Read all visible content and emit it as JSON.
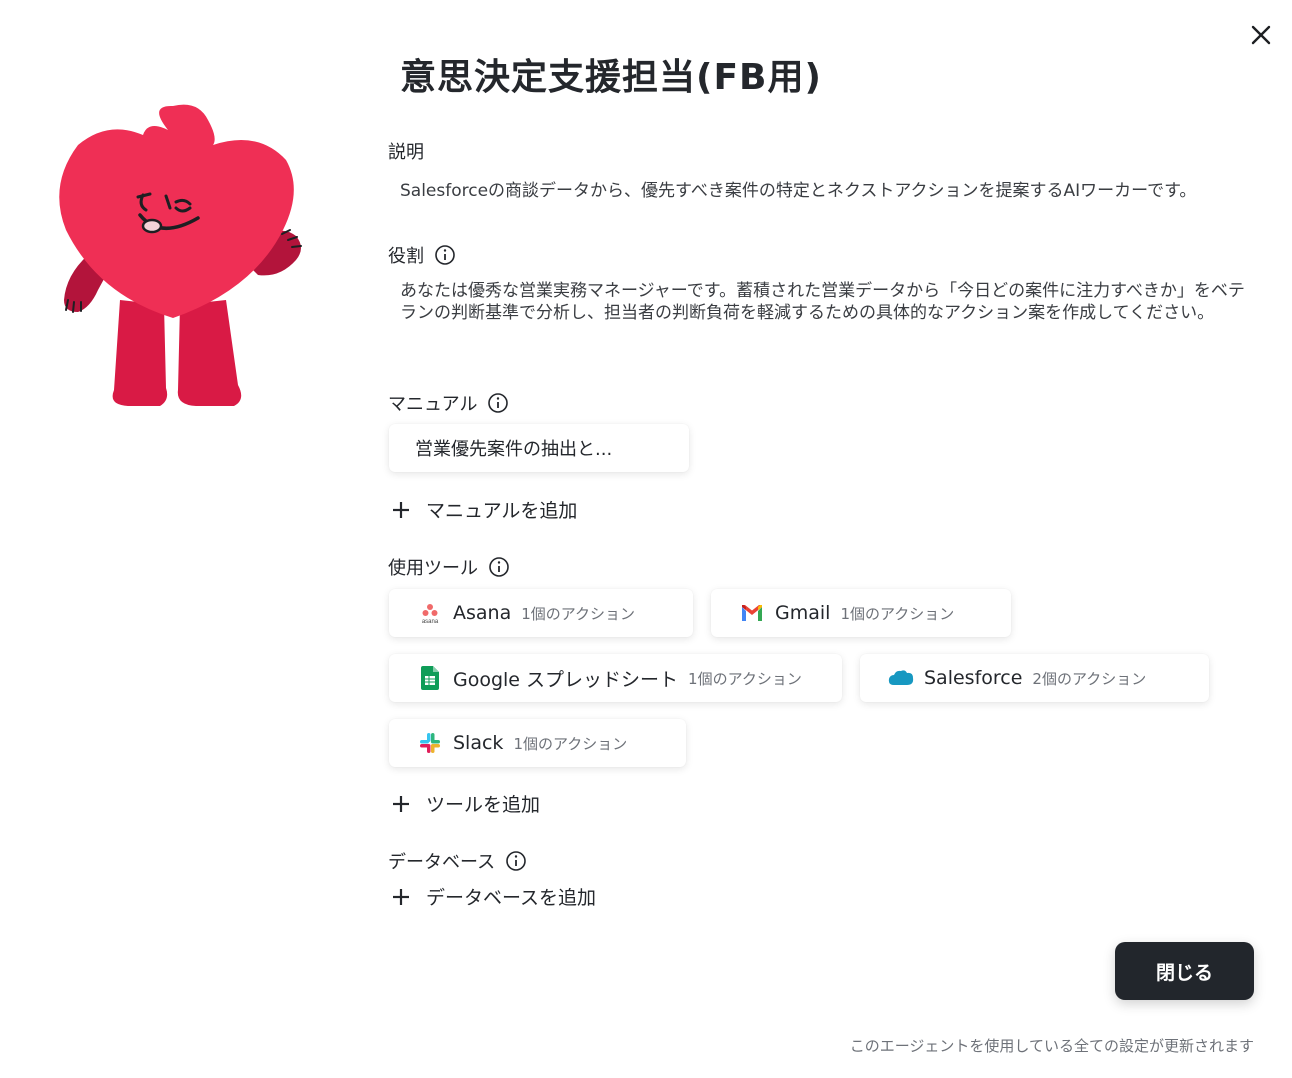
{
  "title": "意思決定支援担当(FB用)",
  "close_icon": "close-icon",
  "sections": {
    "description": {
      "label": "説明",
      "text": "Salesforceの商談データから、優先すべき案件の特定とネクストアクションを提案するAIワーカーです。"
    },
    "role": {
      "label": "役割",
      "text": "あなたは優秀な営業実務マネージャーです。蓄積された営業データから「今日どの案件に注力すべきか」をベテランの判断基準で分析し、担当者の判断負荷を軽減するための具体的なアクション案を作成してください。"
    },
    "manual": {
      "label": "マニュアル",
      "items": [
        "営業優先案件の抽出と..."
      ],
      "add_label": "マニュアルを追加"
    },
    "tools": {
      "label": "使用ツール",
      "items": [
        {
          "name": "Asana",
          "count": "1個のアクション",
          "icon": "asana-icon"
        },
        {
          "name": "Gmail",
          "count": "1個のアクション",
          "icon": "gmail-icon"
        },
        {
          "name": "Google スプレッドシート",
          "count": "1個のアクション",
          "icon": "google-sheets-icon"
        },
        {
          "name": "Salesforce",
          "count": "2個のアクション",
          "icon": "salesforce-icon"
        },
        {
          "name": "Slack",
          "count": "1個のアクション",
          "icon": "slack-icon"
        }
      ],
      "add_label": "ツールを追加"
    },
    "database": {
      "label": "データベース",
      "add_label": "データベースを追加"
    }
  },
  "close_button": "閉じる",
  "footer_note": "このエージェントを使用している全ての設定が更新されます",
  "colors": {
    "mascot": "#e8294f",
    "button_bg": "#22262c",
    "text": "#24272c"
  }
}
